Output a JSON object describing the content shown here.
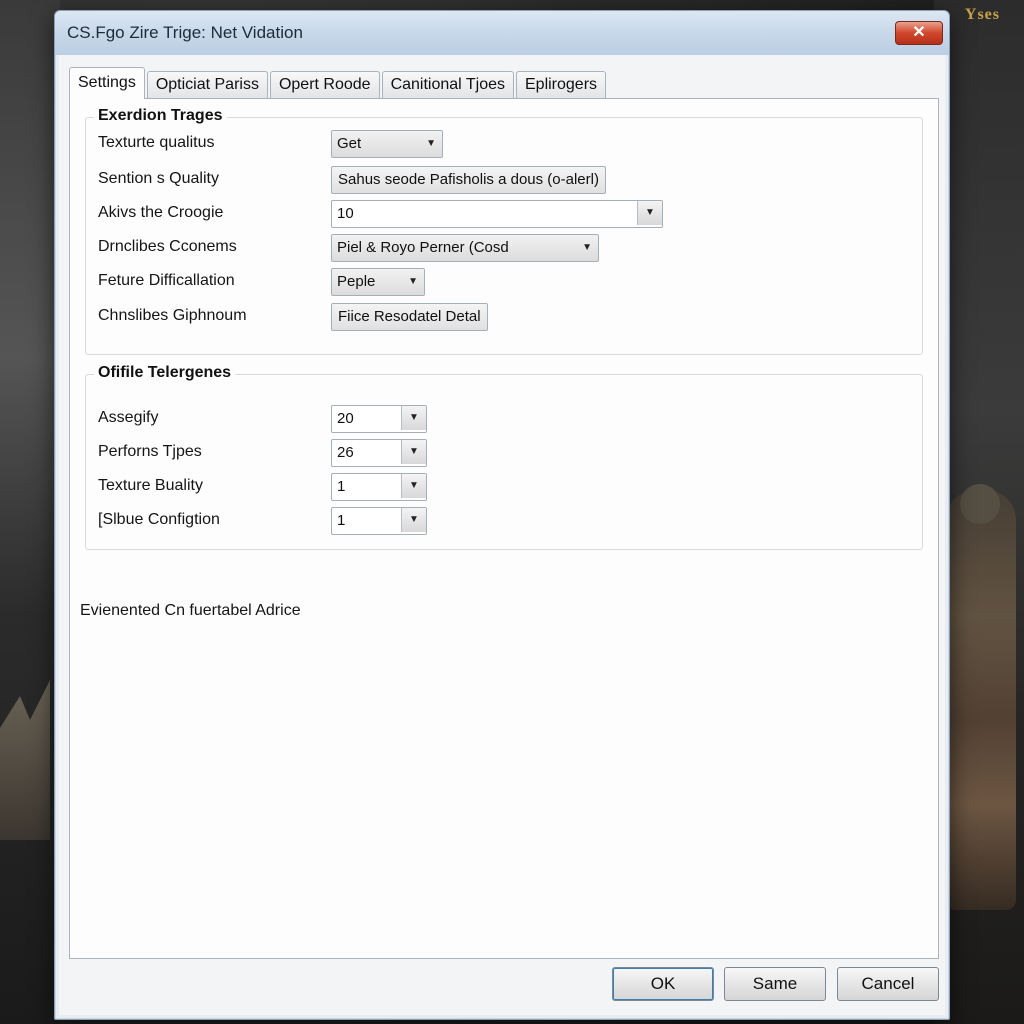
{
  "background": {
    "brand_logo": "Yses"
  },
  "window": {
    "title": "CS.Fgo Zire Trige: Net Vidation",
    "close_label": "✕"
  },
  "tabs": [
    {
      "label": "Settings",
      "active": true
    },
    {
      "label": "Opticiat Pariss",
      "active": false
    },
    {
      "label": "Opert Roode",
      "active": false
    },
    {
      "label": "Canitional Tjoes",
      "active": false
    },
    {
      "label": "Eplirogers",
      "active": false
    }
  ],
  "group1": {
    "title": "Exerdion Trages",
    "rows": [
      {
        "label": "Texturte qualitus",
        "value": "Get",
        "kind": "dropdown"
      },
      {
        "label": "Sention s Quality",
        "value": "Sahus seode Pafisholis a dous (o-alerl)",
        "kind": "button"
      },
      {
        "label": "Akivs the Croogie",
        "value": "10",
        "kind": "edit-combo"
      },
      {
        "label": "Drnclibes Cconems",
        "value": "Piel & Royo Perner (Cosd",
        "kind": "dropdown"
      },
      {
        "label": "Feture Difficallation",
        "value": "Peple",
        "kind": "dropdown"
      },
      {
        "label": "Chnslibes Giphnoum",
        "value": "Fiice Resodatel Detal",
        "kind": "button"
      }
    ]
  },
  "group2": {
    "title": "Ofifile Telergenes",
    "rows": [
      {
        "label": "Assegify",
        "value": "20"
      },
      {
        "label": "Perforns Tjpes",
        "value": "26"
      },
      {
        "label": "Texture Buality",
        "value": "1"
      },
      {
        "label": "[Slbue Configtion",
        "value": "1"
      }
    ]
  },
  "note": "Evienented Cn fuertabel Adrice",
  "buttons": {
    "ok": "OK",
    "same": "Same",
    "cancel": "Cancel"
  },
  "colors": {
    "titlebar": "#c8d8ea",
    "close": "#d0472c",
    "window": "#e9ecf0"
  }
}
